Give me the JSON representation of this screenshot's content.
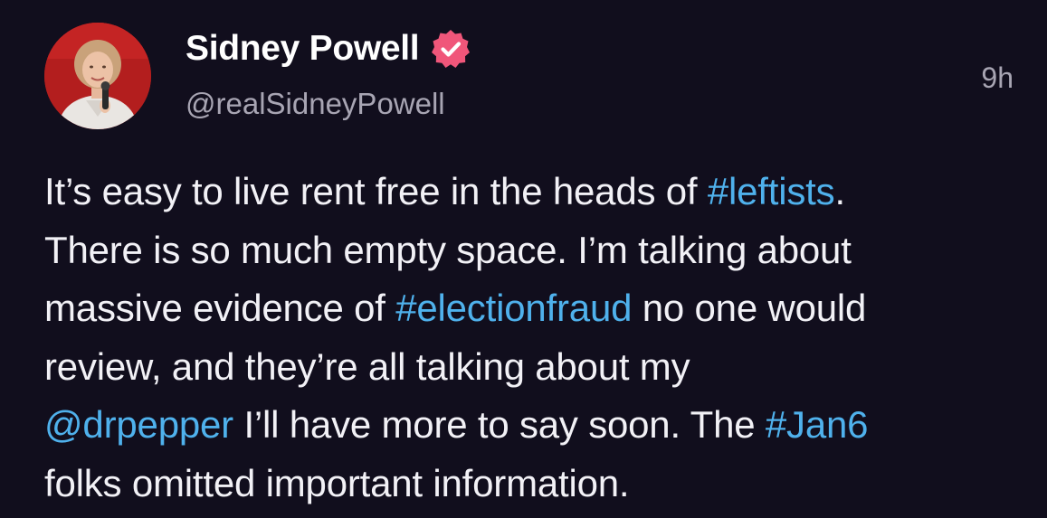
{
  "post": {
    "author": {
      "display_name": "Sidney Powell",
      "handle": "@realSidneyPowell",
      "verified_icon": "verified-badge-icon",
      "avatar_icon": "profile-photo"
    },
    "timestamp": "9h",
    "text_lines": [
      [
        {
          "text": "It’s easy to live rent free in the heads of ",
          "type": "text"
        },
        {
          "text": "#leftists",
          "type": "hashtag"
        },
        {
          "text": ".",
          "type": "text"
        }
      ],
      [
        {
          "text": "There is so much empty space. I’m talking about",
          "type": "text"
        }
      ],
      [
        {
          "text": "massive evidence of ",
          "type": "text"
        },
        {
          "text": "#electionfraud",
          "type": "hashtag"
        },
        {
          "text": " no one would",
          "type": "text"
        }
      ],
      [
        {
          "text": "review, and they’re all talking about my",
          "type": "text"
        }
      ],
      [
        {
          "text": "@drpepper",
          "type": "mention"
        },
        {
          "text": " I’ll have more to say soon. The ",
          "type": "text"
        },
        {
          "text": "#Jan6",
          "type": "hashtag"
        }
      ],
      [
        {
          "text": "folks omitted important information.",
          "type": "text"
        }
      ]
    ]
  },
  "colors": {
    "background": "#110e1d",
    "text": "#f2f1f6",
    "secondary_text": "#a8a5b3",
    "link": "#4fb1ec",
    "verified_badge": "#f0567a"
  }
}
